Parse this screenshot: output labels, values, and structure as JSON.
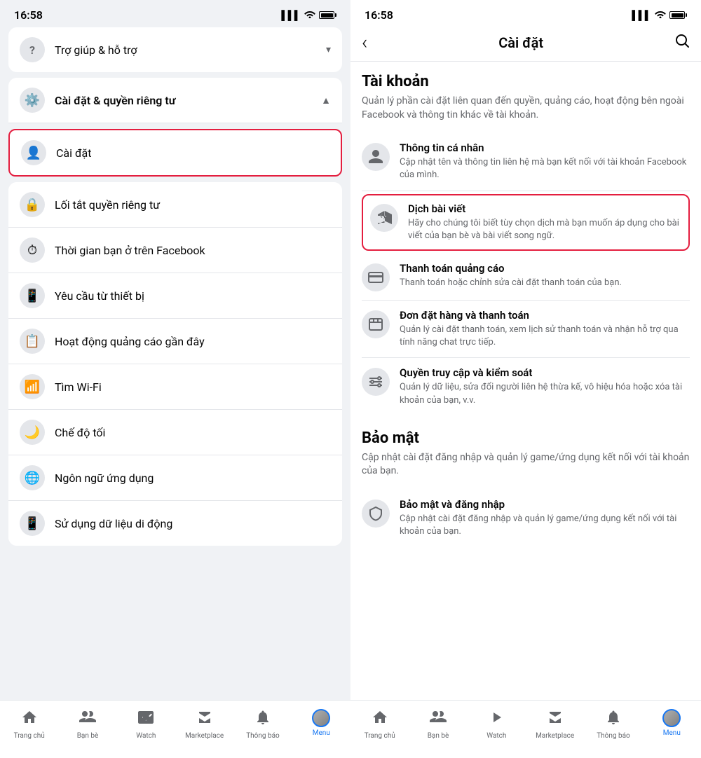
{
  "left": {
    "statusBar": {
      "time": "16:58",
      "signal": "▌▌▌",
      "wifi": "wifi",
      "battery": "100"
    },
    "helpSection": {
      "icon": "?",
      "label": "Trợ giúp & hỗ trợ",
      "chevron": "▾"
    },
    "settingsSection": {
      "icon": "⚙",
      "label": "Cài đặt & quyền riêng tư",
      "chevron": "▲"
    },
    "highlightedItem": {
      "icon": "👤",
      "label": "Cài đặt"
    },
    "subItems": [
      {
        "icon": "🔒",
        "label": "Lối tắt quyền riêng tư"
      },
      {
        "icon": "⏱",
        "label": "Thời gian bạn ở trên Facebook"
      },
      {
        "icon": "📱",
        "label": "Yêu cầu từ thiết bị"
      },
      {
        "icon": "📋",
        "label": "Hoạt động quảng cáo gần đây"
      },
      {
        "icon": "📶",
        "label": "Tìm Wi-Fi"
      },
      {
        "icon": "🌙",
        "label": "Chế độ tối"
      },
      {
        "icon": "🌐",
        "label": "Ngôn ngữ ứng dụng"
      },
      {
        "icon": "📱",
        "label": "Sử dụng dữ liệu di động"
      }
    ],
    "bottomNav": [
      {
        "icon": "⌂",
        "label": "Trang chủ",
        "active": false
      },
      {
        "icon": "👥",
        "label": "Bạn bè",
        "active": false
      },
      {
        "icon": "▶",
        "label": "Watch",
        "active": false
      },
      {
        "icon": "🏪",
        "label": "Marketplace",
        "active": false
      },
      {
        "icon": "🔔",
        "label": "Thông báo",
        "active": false
      },
      {
        "icon": "☰",
        "label": "Menu",
        "active": true
      }
    ]
  },
  "right": {
    "statusBar": {
      "time": "16:58",
      "signal": "▌▌▌",
      "wifi": "wifi",
      "battery": "100"
    },
    "header": {
      "backIcon": "‹",
      "title": "Cài đặt",
      "searchIcon": "⌕"
    },
    "sections": [
      {
        "id": "tai-khoan",
        "title": "Tài khoản",
        "desc": "Quản lý phần cài đặt liên quan đến quyền, quảng cáo, hoạt động bên ngoài Facebook và thông tin khác về tài khoản.",
        "items": [
          {
            "id": "thong-tin-ca-nhan",
            "icon": "👤",
            "title": "Thông tin cá nhân",
            "desc": "Cập nhật tên và thông tin liên hệ mà bạn kết nối với tài khoản Facebook của mình.",
            "highlighted": false
          },
          {
            "id": "dich-bai-viet",
            "icon": "🌐",
            "title": "Dịch bài viết",
            "desc": "Hãy cho chúng tôi biết tùy chọn dịch mà bạn muốn áp dụng cho bài viết của bạn bè và bài viết song ngữ.",
            "highlighted": true
          },
          {
            "id": "thanh-toan-quang-cao",
            "icon": "💳",
            "title": "Thanh toán quảng cáo",
            "desc": "Thanh toán hoặc chỉnh sửa cài đặt thanh toán của bạn.",
            "highlighted": false
          },
          {
            "id": "don-dat-hang",
            "icon": "📦",
            "title": "Đơn đặt hàng và thanh toán",
            "desc": "Quản lý cài đặt thanh toán, xem lịch sử thanh toán và nhận hỗ trợ qua tính năng chat trực tiếp.",
            "highlighted": false
          },
          {
            "id": "quyen-truy-cap",
            "icon": "⚙",
            "title": "Quyền truy cập và kiểm soát",
            "desc": "Quản lý dữ liệu, sửa đổi người liên hệ thừa kế, vô hiệu hóa hoặc xóa tài khoản của bạn, v.v.",
            "highlighted": false
          }
        ]
      },
      {
        "id": "bao-mat",
        "title": "Bảo mật",
        "desc": "Cập nhật cài đặt đăng nhập và quản lý game/ứng dụng kết nối với tài khoản của bạn.",
        "items": [
          {
            "id": "bao-mat-dang-nhap",
            "icon": "🛡",
            "title": "Bảo mật và đăng nhập",
            "desc": "Cập nhật cài đặt đăng nhập và quản lý game/ứng dụng kết nối với tài khoản của bạn.",
            "highlighted": false
          }
        ]
      }
    ],
    "bottomNav": [
      {
        "icon": "⌂",
        "label": "Trang chủ",
        "active": false
      },
      {
        "icon": "👥",
        "label": "Bạn bè",
        "active": false
      },
      {
        "icon": "▶",
        "label": "Watch",
        "active": false
      },
      {
        "icon": "🏪",
        "label": "Marketplace",
        "active": false
      },
      {
        "icon": "🔔",
        "label": "Thông báo",
        "active": false
      },
      {
        "icon": "☰",
        "label": "Menu",
        "active": true
      }
    ]
  }
}
